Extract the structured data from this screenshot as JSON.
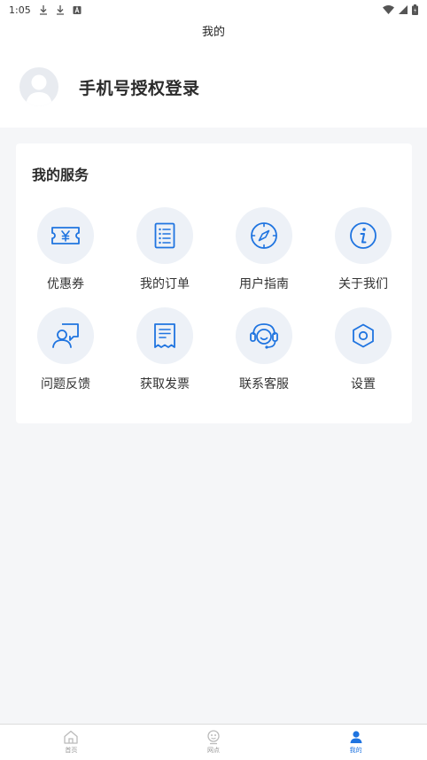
{
  "status_bar": {
    "time": "1:05"
  },
  "header": {
    "title": "我的"
  },
  "profile": {
    "login_text": "手机号授权登录"
  },
  "services": {
    "title": "我的服务",
    "items": [
      {
        "label": "优惠券",
        "icon": "coupon-icon"
      },
      {
        "label": "我的订单",
        "icon": "order-list-icon"
      },
      {
        "label": "用户指南",
        "icon": "compass-icon"
      },
      {
        "label": "关于我们",
        "icon": "info-icon"
      },
      {
        "label": "问题反馈",
        "icon": "feedback-icon"
      },
      {
        "label": "获取发票",
        "icon": "invoice-icon"
      },
      {
        "label": "联系客服",
        "icon": "customer-service-icon"
      },
      {
        "label": "设置",
        "icon": "settings-icon"
      }
    ]
  },
  "tabbar": {
    "tabs": [
      {
        "label": "首页",
        "icon": "home-icon",
        "active": false
      },
      {
        "label": "网点",
        "icon": "outlet-icon",
        "active": false
      },
      {
        "label": "我的",
        "icon": "person-icon",
        "active": true
      }
    ]
  },
  "colors": {
    "accent": "#1f74e0",
    "icon_bg": "#edf1f7",
    "page_bg": "#f5f6f8"
  }
}
